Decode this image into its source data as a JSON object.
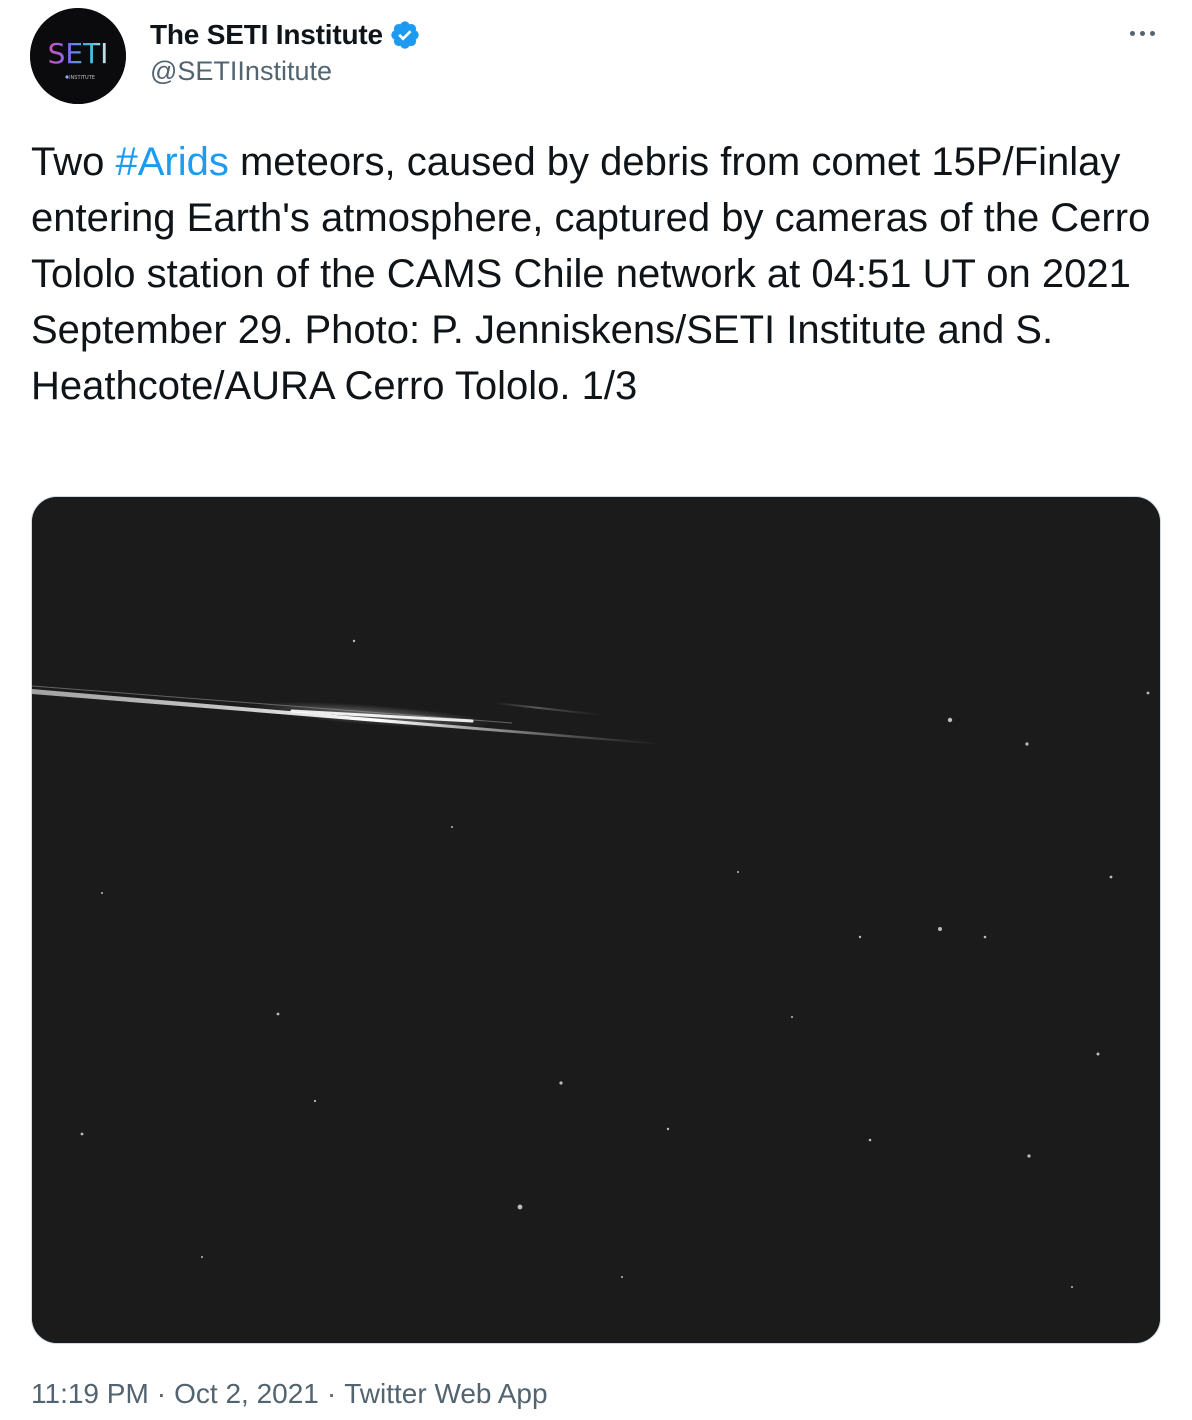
{
  "author": {
    "display_name": "The SETI Institute",
    "handle": "@SETIInstitute",
    "verified": true,
    "avatar_text": "SETI",
    "avatar_subtext": "INSTITUTE"
  },
  "tweet": {
    "text_before_hashtag": "Two ",
    "hashtag": "#Arids",
    "text_after_hashtag": " meteors, caused by debris from comet 15P/Finlay entering Earth's atmosphere, captured by cameras of the Cerro Tololo station of the CAMS Chile network at 04:51 UT on 2021 September 29. Photo: P. Jenniskens/SETI Institute and S. Heathcote/AURA Cerro Tololo. 1/3"
  },
  "meta": {
    "time": "11:19 PM",
    "date": "Oct 2, 2021",
    "source": "Twitter Web App",
    "separator": "·"
  },
  "colors": {
    "hashtag": "#1d9bf0",
    "verified": "#1d9bf0",
    "secondary_text": "#536471",
    "photo_background": "#1b1b1c"
  },
  "icons": {
    "verified": "verified-badge-icon",
    "more": "more-options-icon"
  }
}
